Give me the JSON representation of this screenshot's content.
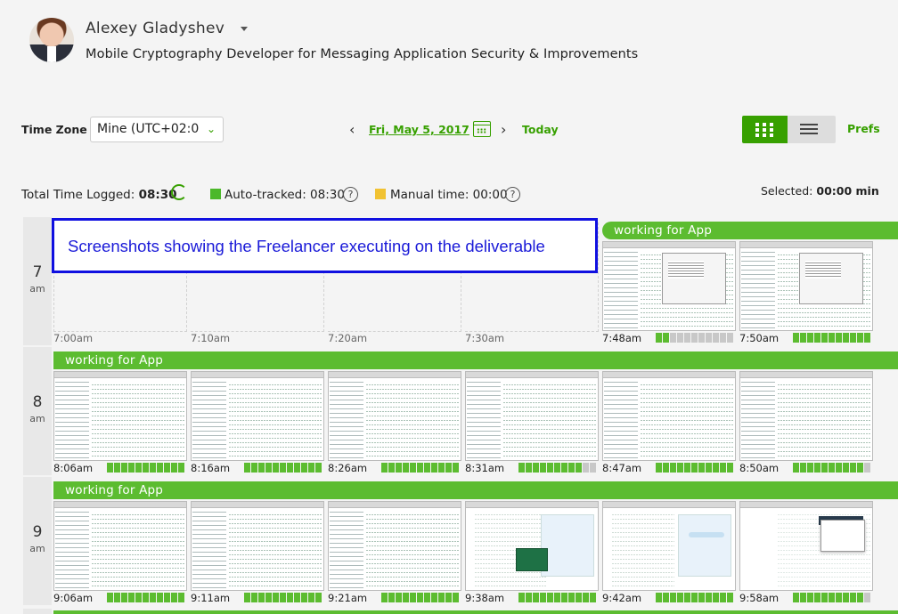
{
  "header": {
    "user_name": "Alexey Gladyshev",
    "job_title": "Mobile Cryptography Developer for Messaging Application Security & Improvements"
  },
  "toolbar": {
    "timezone_label": "Time Zone",
    "timezone_value": "Mine (UTC+02:0",
    "date": "Fri, May 5, 2017",
    "today": "Today",
    "prefs": "Prefs"
  },
  "summary": {
    "total_label": "Total Time Logged:",
    "total_value": "08:30",
    "auto_label": "Auto-tracked: 08:30",
    "manual_label": "Manual time: 00:00",
    "help": "?",
    "selected_label": "Selected:",
    "selected_value": "00:00 min"
  },
  "annotation": "Screenshots showing the Freelancer executing on the deliverable",
  "activity_label": "working for App",
  "hours": [
    {
      "hour": "7",
      "ampm": "am",
      "slots": [
        {
          "time": "7:00am",
          "empty": true
        },
        {
          "time": "7:10am",
          "empty": true
        },
        {
          "time": "7:20am",
          "empty": true
        },
        {
          "time": "7:30am",
          "empty": true
        },
        {
          "time": "7:48am",
          "activity": 0.2,
          "kind": "dialog"
        },
        {
          "time": "7:50am",
          "activity": 1.0,
          "kind": "dialog"
        }
      ]
    },
    {
      "hour": "8",
      "ampm": "am",
      "slots": [
        {
          "time": "8:06am",
          "activity": 1.0,
          "kind": "code"
        },
        {
          "time": "8:16am",
          "activity": 1.0,
          "kind": "code"
        },
        {
          "time": "8:26am",
          "activity": 1.0,
          "kind": "code"
        },
        {
          "time": "8:31am",
          "activity": 0.8,
          "kind": "code"
        },
        {
          "time": "8:47am",
          "activity": 1.0,
          "kind": "code"
        },
        {
          "time": "8:50am",
          "activity": 0.9,
          "kind": "code"
        }
      ]
    },
    {
      "hour": "9",
      "ampm": "am",
      "slots": [
        {
          "time": "9:06am",
          "activity": 1.0,
          "kind": "code"
        },
        {
          "time": "9:11am",
          "activity": 1.0,
          "kind": "code"
        },
        {
          "time": "9:21am",
          "activity": 1.0,
          "kind": "code"
        },
        {
          "time": "9:38am",
          "activity": 1.0,
          "kind": "doc-excel"
        },
        {
          "time": "9:42am",
          "activity": 1.0,
          "kind": "doc-chat"
        },
        {
          "time": "9:58am",
          "activity": 0.9,
          "kind": "browser"
        }
      ]
    }
  ],
  "colors": {
    "accent": "#37a000",
    "activity_bar": "#5cbc30",
    "meter_on": "#5cbc30",
    "meter_off": "#c8c8c8",
    "manual": "#f1c232",
    "annotation_border": "#1010e0"
  },
  "icons": [
    "chevron-left-icon",
    "calendar-icon",
    "chevron-right-icon",
    "grid-view-icon",
    "list-view-icon",
    "refresh-icon",
    "help-icon",
    "caret-down-icon"
  ]
}
